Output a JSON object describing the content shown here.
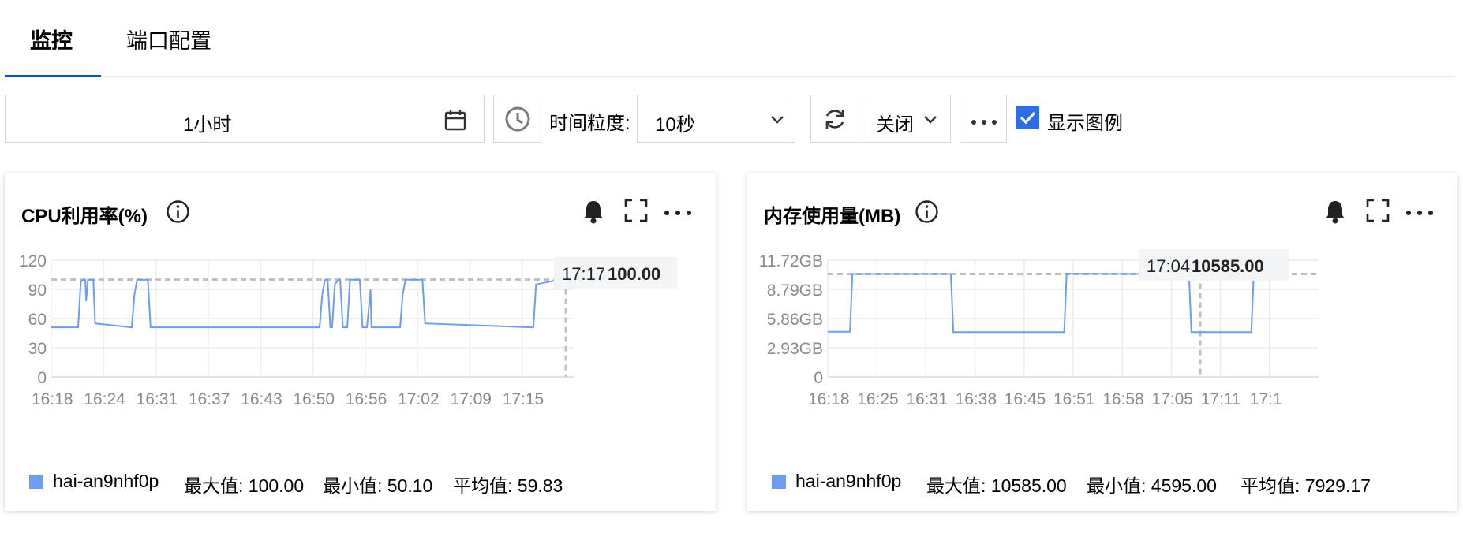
{
  "tabs": [
    {
      "label": "监控",
      "active": true
    },
    {
      "label": "端口配置",
      "active": false
    }
  ],
  "toolbar": {
    "time_range": "1小时",
    "granularity_label": "时间粒度:",
    "granularity_value": "10秒",
    "refresh_value": "关闭",
    "show_legend_label": "显示图例",
    "show_legend_checked": true
  },
  "colors": {
    "accent": "#0052d9",
    "series": "#6e9cee",
    "checkbox": "#2b6ee8"
  },
  "charts": [
    {
      "title": "CPU利用率(%)",
      "tooltip": {
        "time": "17:17",
        "value": "100.00"
      },
      "legend": {
        "name": "hai-an9nhf0p",
        "max": "最大值: 100.00",
        "min": "最小值: 50.10",
        "avg": "平均值: 59.83"
      }
    },
    {
      "title": "内存使用量(MB)",
      "tooltip": {
        "time": "17:04",
        "value": "10585.00"
      },
      "legend": {
        "name": "hai-an9nhf0p",
        "max": "最大值: 10585.00",
        "min": "最小值: 4595.00",
        "avg": "平均值: 7929.17"
      }
    }
  ],
  "chart_data": [
    {
      "type": "line",
      "title": "CPU利用率(%)",
      "ylim": [
        0,
        120
      ],
      "yticks": [
        "120",
        "90",
        "60",
        "30",
        "0"
      ],
      "xticks": [
        "16:18",
        "16:24",
        "16:31",
        "16:37",
        "16:43",
        "16:50",
        "16:56",
        "17:02",
        "17:09",
        "17:15"
      ],
      "xlim": [
        0,
        58.5
      ],
      "grid": true,
      "reference_line": 100,
      "series": [
        {
          "name": "hai-an9nhf0p",
          "x": [
            0,
            3.0,
            3.3,
            3.6,
            3.8,
            3.9,
            4.1,
            4.3,
            4.7,
            4.9,
            9.0,
            9.3,
            9.6,
            10.8,
            11.1,
            30.0,
            30.3,
            30.6,
            30.9,
            31.2,
            31.4,
            31.7,
            32.1,
            32.3,
            32.6,
            33.1,
            33.4,
            34.2,
            34.5,
            34.8,
            35.3,
            35.7,
            35.8,
            35.9,
            36.0,
            39.0,
            39.3,
            39.6,
            41.5,
            41.8,
            53.6,
            53.9,
            54.2,
            56.8,
            57.1,
            57.5,
            57.9,
            58.5
          ],
          "y": [
            51,
            51,
            98,
            100,
            100,
            78,
            100,
            100,
            100,
            55,
            51,
            85,
            100,
            100,
            51,
            51,
            85,
            100,
            100,
            51,
            51,
            95,
            100,
            100,
            51,
            51,
            100,
            100,
            100,
            51,
            51,
            90,
            51,
            51,
            51,
            51,
            85,
            100,
            100,
            55,
            51,
            51,
            95,
            100,
            100,
            99,
            96,
            100
          ]
        }
      ]
    },
    {
      "type": "line",
      "title": "内存使用量(MB)",
      "ylim": [
        0,
        12000
      ],
      "yticks": [
        "11.72GB",
        "8.79GB",
        "5.86GB",
        "2.93GB",
        "0"
      ],
      "xticks": [
        "16:18",
        "16:25",
        "16:31",
        "16:38",
        "16:45",
        "16:51",
        "16:58",
        "17:05",
        "17:11",
        "17:1"
      ],
      "xlim": [
        0,
        59.8
      ],
      "grid": true,
      "reference_line": 10585,
      "series": [
        {
          "name": "hai-an9nhf0p",
          "x": [
            0,
            2.7,
            3.0,
            15.0,
            15.3,
            28.8,
            29.1,
            44.0,
            44.3,
            51.6,
            51.9,
            52.2,
            52.5,
            52.8,
            53.1,
            53.4
          ],
          "y": [
            4640,
            4640,
            10585,
            10585,
            4595,
            4595,
            10600,
            10580,
            4595,
            4595,
            10520,
            10520,
            10500,
            10500,
            10500,
            10530
          ]
        }
      ]
    }
  ]
}
